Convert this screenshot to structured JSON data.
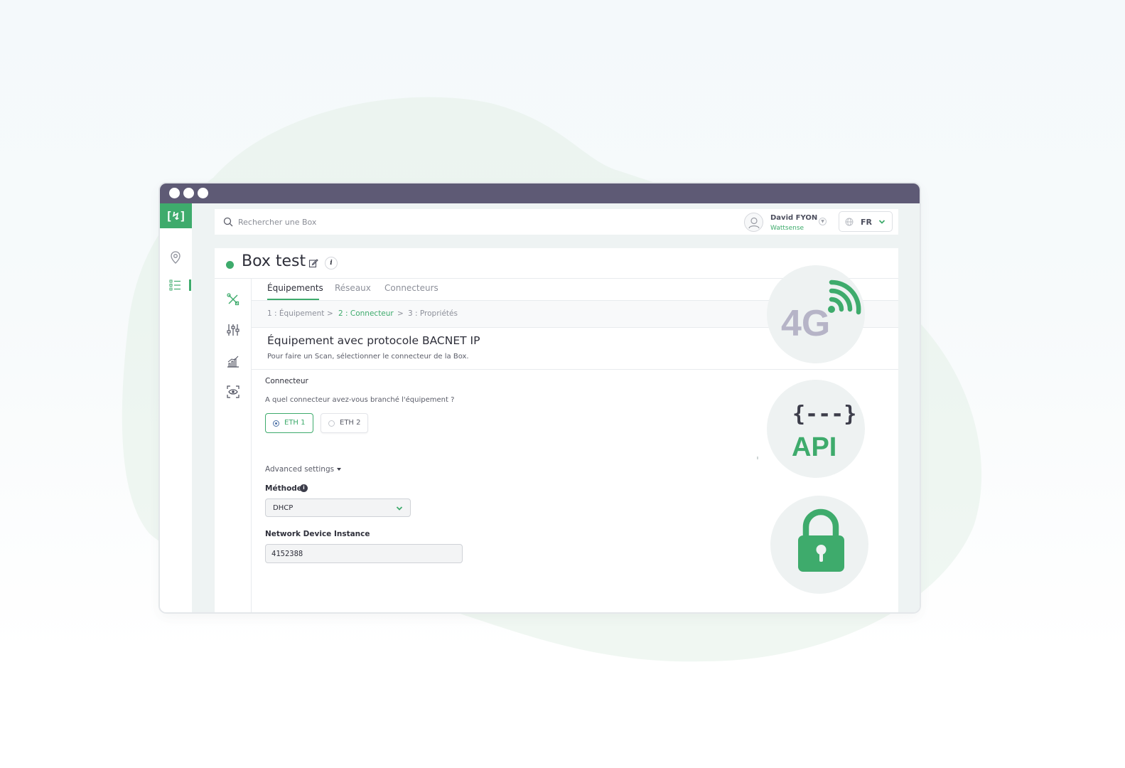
{
  "colors": {
    "accent": "#3eab6c",
    "titlebar": "#5e5a75",
    "badge_bg": "#eef2f2",
    "fourg_text": "#b6b4c7"
  },
  "app": {
    "logo_text": "[↯]",
    "rail_icons": [
      "map-pin-icon",
      "list-icon"
    ]
  },
  "topbar": {
    "search_placeholder": "Rechercher une Box",
    "user_name": "David FYON",
    "user_org": "Wattsense",
    "language": "FR"
  },
  "page": {
    "title": "Box test",
    "info_glyph": "i",
    "side_icons": [
      "tools-icon",
      "sliders-icon",
      "chart-icon",
      "eye-scan-icon"
    ],
    "tabs": [
      {
        "label": "Équipements",
        "active": true
      },
      {
        "label": "Réseaux",
        "active": false
      },
      {
        "label": "Connecteurs",
        "active": false
      }
    ],
    "breadcrumb": {
      "step1": "1 : Équipement",
      "sep1": ">",
      "step2": "2 : Connecteur",
      "sep2": ">",
      "step3": "3 : Propriétés",
      "current_step": 2
    }
  },
  "form": {
    "section_title": "Équipement avec protocole BACNET IP",
    "section_subtitle": "Pour faire un Scan, sélectionner le connecteur de la Box.",
    "connector_label": "Connecteur",
    "connector_question": "A quel connecteur avez-vous branché l'équipement ?",
    "connector_options": [
      {
        "label": "ETH 1",
        "selected": true
      },
      {
        "label": "ETH 2",
        "selected": false
      }
    ],
    "advanced_label": "Advanced settings",
    "method_label": "Méthode",
    "method_info_glyph": "i",
    "method_value": "DHCP",
    "ndi_label": "Network Device Instance",
    "ndi_value": "4152388"
  },
  "badges": {
    "fourg_text": "4G",
    "api_braces": "{---}",
    "api_text": "API",
    "lock_icon": "padlock-icon"
  }
}
